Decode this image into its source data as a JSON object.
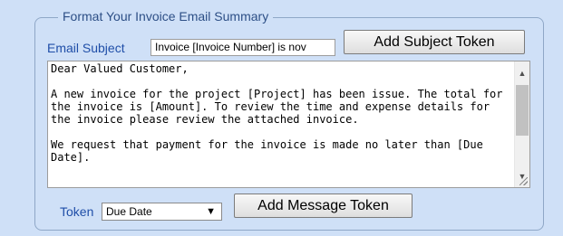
{
  "form": {
    "legend": "Format Your Invoice Email Summary",
    "subject_label": "Email Subject",
    "subject_value": "Invoice [Invoice Number] is nov",
    "add_subject_token_label": "Add Subject Token",
    "message_text": "Dear Valued Customer,\n\nA new invoice for the project [Project] has been issue. The total for the invoice is [Amount]. To review the time and expense details for the invoice please review the attached invoice.\n\nWe request that payment for the invoice is made no later than [Due Date].",
    "token_label": "Token",
    "token_selected": "Due Date",
    "add_message_token_label": "Add Message Token"
  },
  "icons": {
    "scroll_up": "▲",
    "scroll_down": "▼",
    "dropdown": "▼"
  },
  "colors": {
    "background": "#cfe0f7",
    "label_blue": "#1f4ea8",
    "legend_blue": "#2d4f86"
  }
}
